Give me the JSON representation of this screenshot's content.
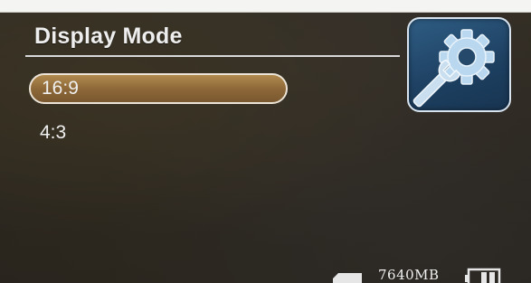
{
  "menu": {
    "title": "Display Mode",
    "options": [
      {
        "label": "16:9",
        "selected": true
      },
      {
        "label": "4:3",
        "selected": false
      }
    ]
  },
  "icons": {
    "settings": "settings-gear-wrench-icon",
    "sd_card": "sd-card-icon",
    "battery": "battery-icon"
  },
  "status": {
    "storage": "7640MB"
  },
  "colors": {
    "selection_fill": "#8b6637",
    "selection_border": "#ece4d6",
    "icon_tile": "#2f5d84",
    "text": "#f0f0f0"
  }
}
